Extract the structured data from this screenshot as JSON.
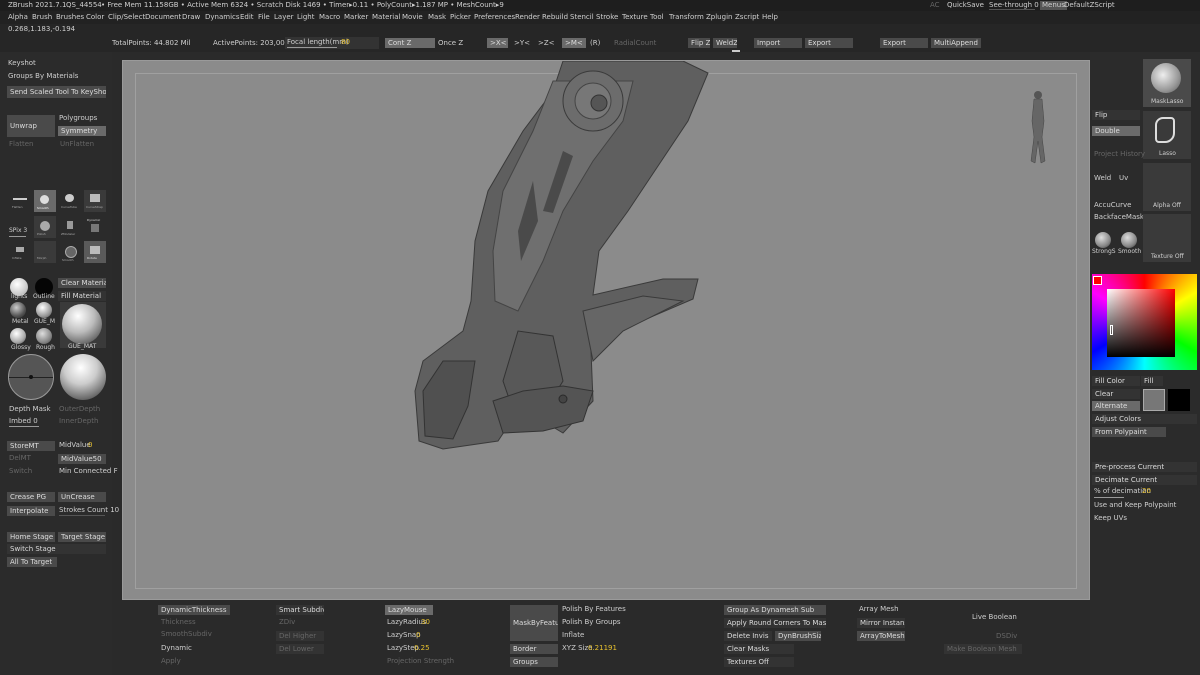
{
  "titlebar": {
    "app": "ZBrush 2021.7.1",
    "doc": "QS_44554",
    "stats": "• Free Mem 11.158GB • Active Mem 6324 • Scratch Disk 1469 • Timer▸0.11 • PolyCount▸1.187 MP • MeshCount▸9",
    "ac": "AC",
    "quicksave": "QuickSave",
    "see_through": "See-through  0",
    "menus": "Menus",
    "script": "DefaultZScript"
  },
  "menu": [
    "Alpha",
    "Brush",
    "Brushes",
    "Color",
    "Clip/Select",
    "Document",
    "Draw",
    "Dynamics",
    "Edit",
    "File",
    "Layer",
    "Light",
    "Macro",
    "Marker",
    "Material",
    "Movie",
    "Mask",
    "Picker",
    "Preferences",
    "Render",
    "Rebuild",
    "Stencil",
    "Stroke",
    "Texture",
    "Tool",
    "Transform",
    "Zplugin",
    "Zscript",
    "Help"
  ],
  "coords": "0.268,1.183,-0.194",
  "topbar": {
    "total_points": "TotalPoints: 44.802 Mil",
    "active_points": "ActivePoints: 203,006",
    "focal_label": "Focal length(mm)",
    "focal_value": "80",
    "cont_z": "Cont Z",
    "once_z": "Once Z",
    "axis_x": ">X<",
    "axis_y": ">Y<",
    "axis_z": ">Z<",
    "axis_m": ">M<",
    "r": "(R)",
    "radial": "RadialCount",
    "flip_z": "Flip Z",
    "weld_z": "WeldZ",
    "import": "Import",
    "export1": "Export",
    "export2": "Export",
    "multiappend": "MultiAppend"
  },
  "left": {
    "keyshot": "Keyshot",
    "groups_by_materials": "Groups By Materials",
    "send_scaled": "Send Scaled Tool To KeyShot",
    "unwrap": "Unwrap",
    "polygroups": "Polygroups",
    "symmetry": "Symmetry",
    "flatten": "Flatten",
    "unflatten": "UnFlatten",
    "spix": "SPix 3",
    "brush_labels": [
      "Flatten",
      "Smooth",
      "CurveTube",
      "CurveStrap",
      "Polish",
      "ZModeler",
      "Dynamic",
      "Inflate",
      "Morph",
      "Smooth",
      "Rotate",
      "Relax"
    ],
    "lights": "lights",
    "outline": "Outline",
    "clear_material": "Clear Material",
    "fill_material": "Fill Material",
    "metal": "Metal",
    "gue_m": "GUE_M",
    "gue_mat": "GUE_MAT",
    "glossy": "Glossy",
    "rough": "Rough",
    "depth_mask": "Depth Mask",
    "outer_depth": "OuterDepth",
    "imbed": "Imbed 0",
    "inner_depth": "InnerDepth",
    "store_mt": "StoreMT",
    "mid_value": "MidValue",
    "mid_value_num": "0",
    "del_mt": "DelMT",
    "mid_value50": "MidValue50",
    "switch": "Switch",
    "min_connected": "Min Connected F",
    "crease_pg": "Crease PG",
    "uncrease": "UnCrease",
    "interpolate": "Interpolate",
    "strokes_count": "Strokes Count 10",
    "home_stage": "Home Stage",
    "target_stage": "Target Stage",
    "switch_stage": "Switch Stage",
    "all_to_target": "All To Target"
  },
  "right": {
    "masklasso": "MaskLasso",
    "flip": "Flip",
    "double": "Double",
    "lasso": "Lasso",
    "project_history": "Project History",
    "weld": "Weld",
    "uv": "Uv",
    "accucurve": "AccuCurve",
    "alpha_off": "Alpha Off",
    "backface_mask": "BackfaceMask",
    "strong": "StrongS",
    "smooth": "Smooth",
    "texture_off": "Texture Off",
    "fill_color": "Fill Color",
    "fill": "Fill",
    "clear": "Clear",
    "alternate": "Alternate",
    "adjust_colors": "Adjust Colors",
    "from_polypaint": "From Polypaint",
    "preprocess": "Pre-process Current",
    "decimate": "Decimate Current",
    "pct_decimation": "% of decimation",
    "pct_value": "20",
    "use_keep_polypaint": "Use and Keep Polypaint",
    "keep_uvs": "Keep UVs",
    "primary_color": "#000000",
    "secondary_color": "#777777"
  },
  "bottom": {
    "dynamic_thickness": "DynamicThickness",
    "thickness": "Thickness",
    "smooth_subdiv": "SmoothSubdiv",
    "dynamic": "Dynamic",
    "apply": "Apply",
    "smart_subdiv": "Smart Subdiv",
    "zdiv": "ZDiv",
    "del_higher": "Del Higher",
    "del_lower": "Del Lower",
    "lazymouse": "LazyMouse",
    "lazyradius": "LazyRadius",
    "lazyradius_val": "30",
    "lazysnap": "LazySnap",
    "lazysnap_val": "0",
    "lazystep": "LazyStep",
    "lazystep_val": "0.25",
    "projection_strength": "Projection Strength",
    "mask_by_feature": "MaskByFeature",
    "border": "Border",
    "groups": "Groups",
    "polish_features": "Polish By Features",
    "polish_groups": "Polish By Groups",
    "inflate": "Inflate",
    "xyz_size": "XYZ Size",
    "xyz_val": "0.21191",
    "group_dynamesh": "Group As Dynamesh Sub",
    "round_corners": "Apply Round Corners To Mask",
    "delete_invis": "Delete Invis",
    "dynbrushsize": "DynBrushSize",
    "clear_masks": "Clear Masks",
    "textures_off": "Textures Off",
    "array_mesh": "Array Mesh",
    "mirror_instans": "Mirror Instans",
    "array_to_mesh": "ArrayToMesh",
    "live_boolean": "Live Boolean",
    "dsdiv": "DSDiv",
    "make_boolean": "Make Boolean Mesh"
  }
}
